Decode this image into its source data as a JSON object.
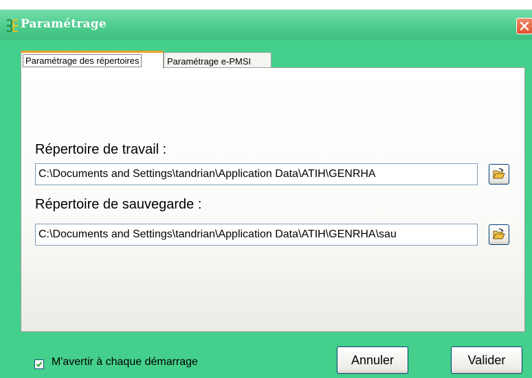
{
  "window": {
    "caption_fragment": "",
    "title": "Paramétrage",
    "icon": "app-logo-icon",
    "close_icon": "close-icon"
  },
  "tabs": [
    {
      "label": "Paramétrage des répertoires",
      "active": true
    },
    {
      "label": "Paramétrage e-PMSI",
      "active": false
    }
  ],
  "work_dir": {
    "label": "Répertoire de travail :",
    "value": "C:\\Documents and Settings\\tandrian\\Application Data\\ATIH\\GENRHA",
    "browse_icon": "open-folder-icon"
  },
  "backup_dir": {
    "label": "Répertoire de sauvegarde :",
    "value": "C:\\Documents and Settings\\tandrian\\Application Data\\ATIH\\GENRHA\\sau",
    "browse_icon": "open-folder-icon"
  },
  "warn_on_startup": {
    "label": "M'avertir à chaque démarrage",
    "checked": true
  },
  "buttons": {
    "cancel": "Annuler",
    "ok": "Valider"
  },
  "colors": {
    "window_frame": "#44d08c",
    "title_text": "#ffffff",
    "close_button": "#e2542f",
    "active_tab_accent": "#f0a030"
  }
}
